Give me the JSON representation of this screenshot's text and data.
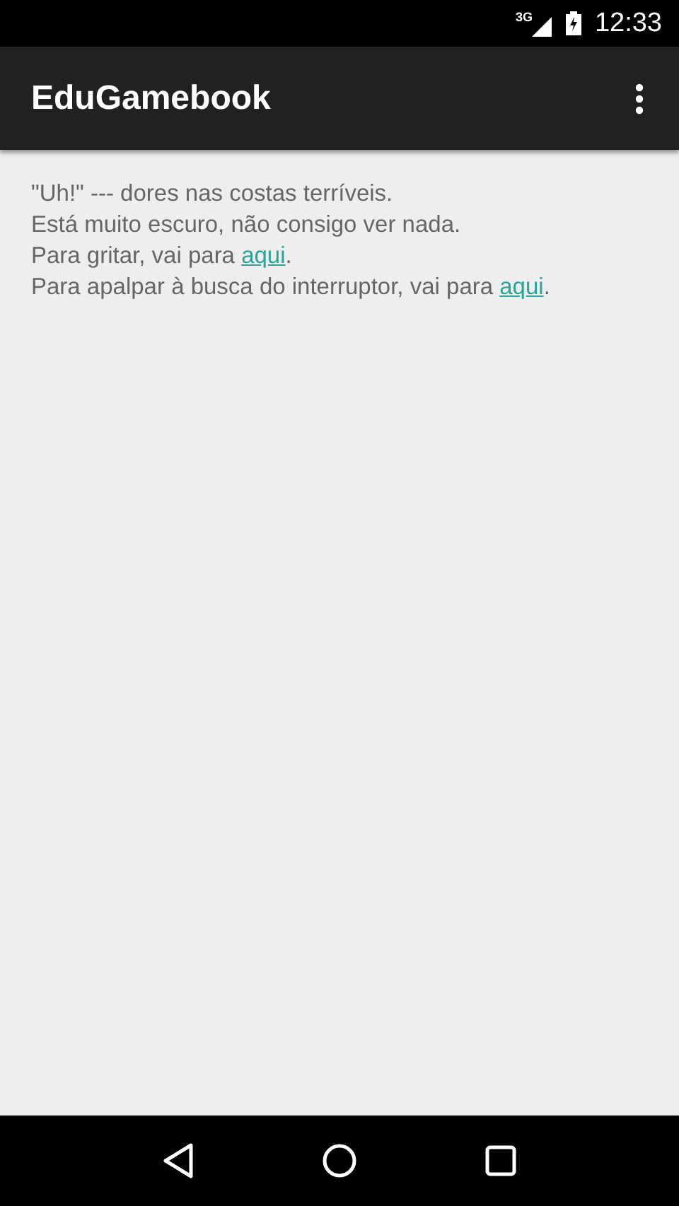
{
  "status_bar": {
    "network": "3G",
    "time": "12:33"
  },
  "app_bar": {
    "title": "EduGamebook"
  },
  "content": {
    "lines": [
      {
        "kind": "plain",
        "text": "\"Uh!\" --- dores nas costas terríveis."
      },
      {
        "kind": "plain",
        "text": "Está muito escuro, não consigo ver nada."
      },
      {
        "kind": "link",
        "before": "Para gritar, vai para ",
        "link": "aqui",
        "after": "."
      },
      {
        "kind": "link",
        "before": "Para apalpar à busca do interruptor, vai para ",
        "link": "aqui",
        "after": "."
      }
    ]
  }
}
